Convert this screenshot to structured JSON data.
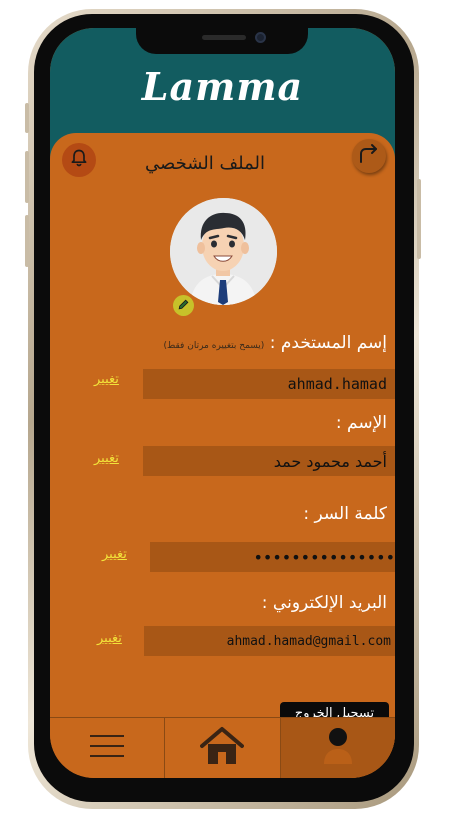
{
  "app": {
    "logo_text": "Lamma"
  },
  "header": {
    "title": "الملف الشخصي"
  },
  "profile": {
    "username": {
      "label": "إسم المستخدم :",
      "hint": "(يسمح بتغييره مرتان فقط)",
      "value": "ahmad.hamad",
      "change_label": "تغيير"
    },
    "name": {
      "label": "الإسم :",
      "value": "أحمد محمود حمد",
      "change_label": "تغيير"
    },
    "password": {
      "label": "كلمة السر :",
      "value": "•••••••••••••••",
      "change_label": "تغيير"
    },
    "email": {
      "label": "البريد الإلكتروني :",
      "value": "ahmad.hamad@gmail.com",
      "change_label": "تغيير"
    }
  },
  "actions": {
    "logout_label": "تسجيل الخروج"
  },
  "nav": {
    "items": [
      {
        "icon": "menu-icon"
      },
      {
        "icon": "home-icon"
      },
      {
        "icon": "profile-icon",
        "active": true
      }
    ]
  },
  "colors": {
    "header_bg": "#125c60",
    "panel_bg": "#c8681c",
    "field_bg": "#a85716",
    "link": "#f2e23a"
  }
}
